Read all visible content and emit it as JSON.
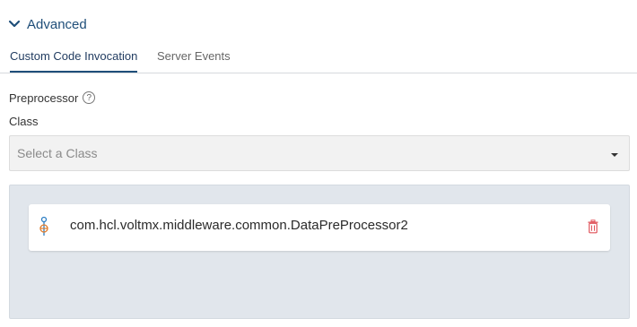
{
  "section": {
    "title": "Advanced"
  },
  "tabs": [
    {
      "label": "Custom Code Invocation",
      "active": true
    },
    {
      "label": "Server Events",
      "active": false
    }
  ],
  "preprocessor": {
    "label": "Preprocessor",
    "help_glyph": "?",
    "class_label": "Class",
    "select_placeholder": "Select a Class"
  },
  "classes": [
    {
      "name": "com.hcl.voltmx.middleware.common.DataPreProcessor2",
      "icon": "code-class-icon"
    }
  ],
  "colors": {
    "accent": "#1f4e79",
    "panel_bg": "#e1e6ec",
    "delete": "#e0525a",
    "class_icon_primary": "#2e7fc4",
    "class_icon_secondary": "#e07b2a"
  }
}
